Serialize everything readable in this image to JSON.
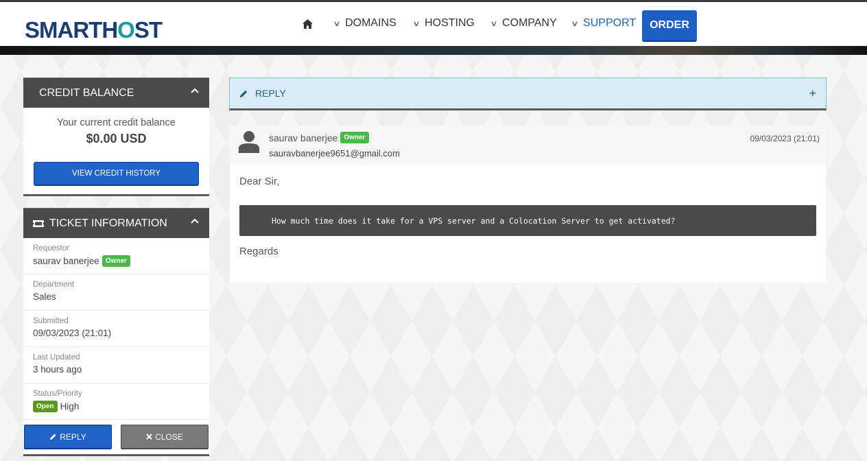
{
  "header": {
    "logo_pre": "SMARTH",
    "logo_o": "O",
    "logo_post": "ST",
    "nav": {
      "home_icon": "home-icon",
      "domains": "DOMAINS",
      "hosting": "HOSTING",
      "company": "COMPANY",
      "support": "SUPPORT",
      "order": "ORDER"
    },
    "active_color": "#1f5fb5"
  },
  "credit": {
    "title": "CREDIT BALANCE",
    "text": "Your current credit balance",
    "amount": "$0.00 USD",
    "button": "VIEW CREDIT HISTORY"
  },
  "ticket": {
    "title": "TICKET INFORMATION",
    "rows": [
      {
        "label": "Requestor",
        "value": "saurav banerjee",
        "badge": "Owner"
      },
      {
        "label": "Department",
        "value": "Sales"
      },
      {
        "label": "Submitted",
        "value": "09/03/2023 (21:01)"
      },
      {
        "label": "Last Updated",
        "value": "3 hours ago"
      },
      {
        "label": "Status/Priority",
        "status": "Open",
        "value": "High"
      }
    ],
    "reply_button": "REPLY",
    "close_button": "CLOSE"
  },
  "reply_bar": {
    "label": "REPLY",
    "toggle": "+"
  },
  "message": {
    "author": "saurav banerjee",
    "badge": "Owner",
    "email": "sauravbanerjee9651@gmail.com",
    "date": "09/03/2023 (21:01)",
    "greeting": "Dear Sir,",
    "code": "How much time does it take for a VPS server and a Colocation Server to get activated?",
    "closing": "Regards"
  },
  "colors": {
    "primary_blue": "#1f63c8",
    "panel_header": "#4a4a4a",
    "owner_badge": "#4cb84c",
    "open_badge": "#5a9a1a",
    "reply_bar_bg": "#d9edf7"
  }
}
